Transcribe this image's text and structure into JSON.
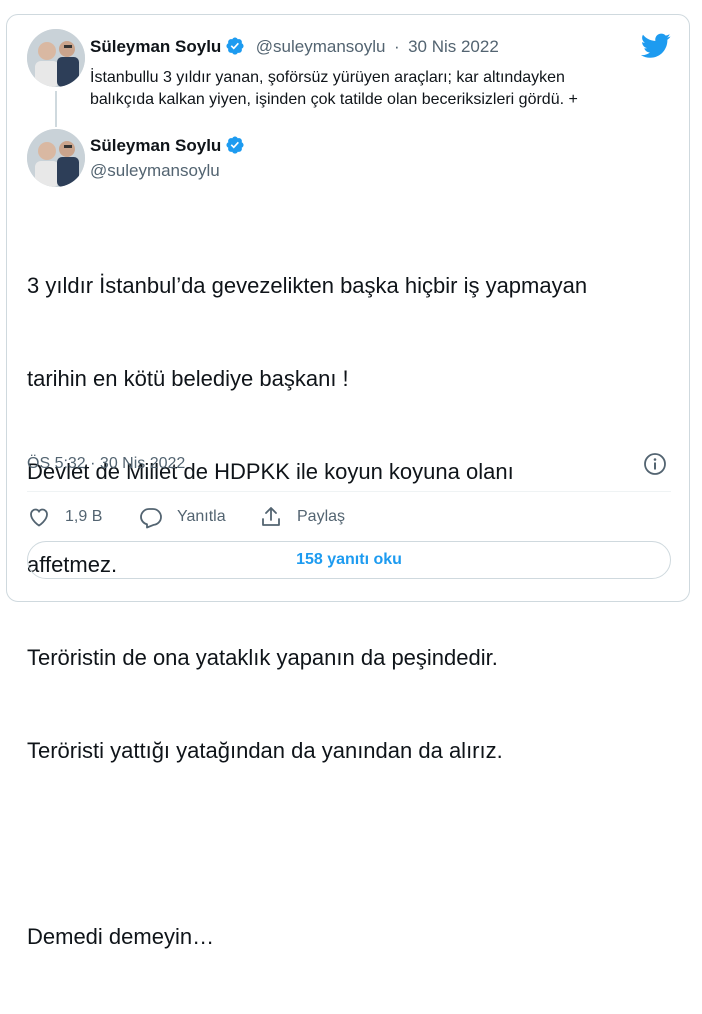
{
  "quoted_tweet": {
    "display_name": "Süleyman Soylu",
    "handle": "@suleymansoylu",
    "separator": "·",
    "date": "30 Nis 2022",
    "text_line1": "İstanbullu 3 yıldır yanan, şoförsüz yürüyen araçları; kar altındayken",
    "text_line2": "balıkçıda kalkan yiyen, işinden çok tatilde olan beceriksizleri gördü. +"
  },
  "main_tweet": {
    "display_name": "Süleyman Soylu",
    "handle": "@suleymansoylu",
    "lines": [
      "3 yıldır İstanbul’da gevezelikten başka hiçbir iş yapmayan",
      "tarihin en kötü belediye başkanı !",
      "Devlet de Millet de HDPKK ile koyun koyuna olanı",
      "affetmez.",
      "Teröristin de ona yataklık yapanın da peşindedir.",
      "Teröristi yattığı yatağından da yanından da alırız.",
      "",
      "Demedi demeyin…"
    ],
    "timestamp": "ÖS 5:32 · 30 Nis 2022"
  },
  "actions": {
    "like_count": "1,9 B",
    "reply_label": "Yanıtla",
    "share_label": "Paylaş"
  },
  "replies_button": "158 yanıtı oku",
  "icons": {
    "brand": "twitter-bird-icon",
    "verified": "verified-badge-icon",
    "info": "info-icon",
    "like": "heart-icon",
    "reply": "reply-bubble-icon",
    "share": "share-icon"
  },
  "colors": {
    "accent": "#1d9bf0",
    "text": "#0f1419",
    "muted": "#536471",
    "border": "#cfd9de"
  }
}
